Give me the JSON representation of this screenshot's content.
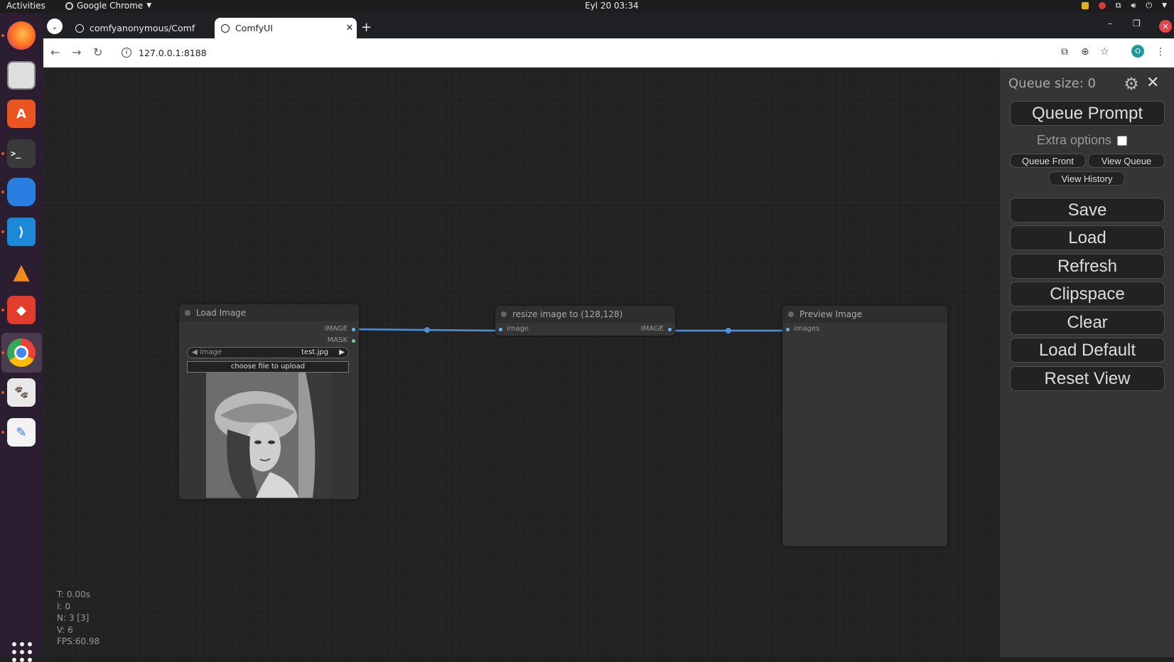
{
  "system_bar": {
    "activities": "Activities",
    "app_name": "Google Chrome",
    "clock": "Eyl 20  03:34"
  },
  "browser": {
    "tabs": [
      {
        "title": "comfyanonymous/Comf"
      },
      {
        "title": "ComfyUI"
      }
    ],
    "url": "127.0.0.1:8188",
    "profile_initial": "O"
  },
  "nodes": {
    "load_image": {
      "title": "Load Image",
      "outputs": [
        "IMAGE",
        "MASK"
      ],
      "widget_label": "image",
      "widget_value": "test.jpg",
      "upload_label": "choose file to upload"
    },
    "resize": {
      "title": "resize image to (128,128)",
      "input": "image",
      "output": "IMAGE"
    },
    "preview": {
      "title": "Preview Image",
      "input": "images"
    }
  },
  "stats": {
    "t": "T: 0.00s",
    "i": "I: 0",
    "n": "N: 3 [3]",
    "v": "V: 6",
    "fps": "FPS:60.98"
  },
  "menu": {
    "queue_size": "Queue size: 0",
    "queue_prompt": "Queue Prompt",
    "extra_options": "Extra options",
    "queue_front": "Queue Front",
    "view_queue": "View Queue",
    "view_history": "View History",
    "save": "Save",
    "load": "Load",
    "refresh": "Refresh",
    "clipspace": "Clipspace",
    "clear": "Clear",
    "load_default": "Load Default",
    "reset_view": "Reset View"
  },
  "colors": {
    "link": "#4f90d8",
    "accent_red": "#e95420",
    "menu_bg": "#353535",
    "canvas_bg": "#222222"
  }
}
